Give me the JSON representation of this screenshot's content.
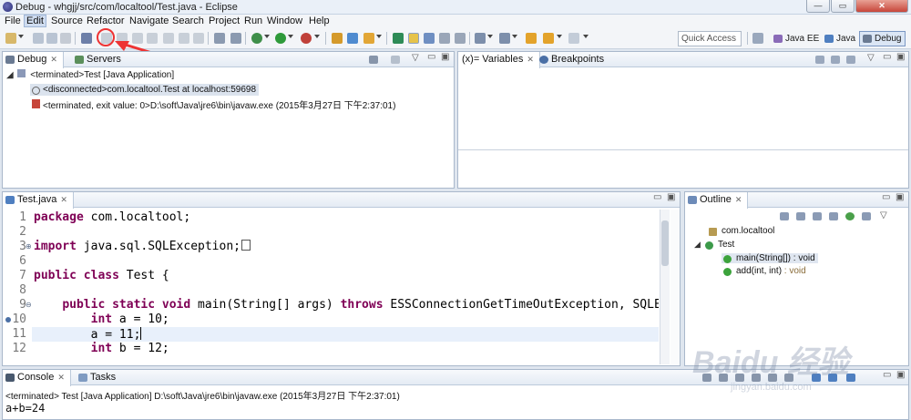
{
  "window": {
    "title": "Debug - whgjj/src/com/localtool/Test.java - Eclipse",
    "minimize_symbol": "—",
    "maximize_symbol": "▭",
    "close_symbol": "✕"
  },
  "menu": [
    "File",
    "Edit",
    "Source",
    "Refactor",
    "Navigate",
    "Search",
    "Project",
    "Run",
    "Window",
    "Help"
  ],
  "menu_active": "Edit",
  "toolbar": {
    "quick_access_placeholder": "Quick Access",
    "perspectives": [
      "Java EE",
      "Java",
      "Debug"
    ],
    "active_perspective": "Debug"
  },
  "debug_view": {
    "tabs": [
      "Debug",
      "Servers"
    ],
    "tree": [
      "<terminated>Test [Java Application]",
      "<disconnected>com.localtool.Test at localhost:59698",
      "<terminated, exit value: 0>D:\\soft\\Java\\jre6\\bin\\javaw.exe (2015年3月27日 下午2:37:01)"
    ]
  },
  "variables_view": {
    "tabs": [
      "(x)= Variables",
      "Breakpoints"
    ]
  },
  "editor": {
    "tab": "Test.java",
    "lines": [
      {
        "num": "1",
        "code": [
          {
            "t": "package",
            "kw": true
          },
          {
            "t": " com.localtool;"
          }
        ]
      },
      {
        "num": "2",
        "code": []
      },
      {
        "num": "3",
        "code": [
          {
            "t": "import",
            "kw": true
          },
          {
            "t": " java.sql.SQLException;"
          }
        ],
        "fold": "+",
        "box": true
      },
      {
        "num": "6",
        "code": []
      },
      {
        "num": "7",
        "code": [
          {
            "t": "public class",
            "kw": true
          },
          {
            "t": " Test {"
          }
        ]
      },
      {
        "num": "8",
        "code": []
      },
      {
        "num": "9",
        "code": [
          {
            "t": "    "
          },
          {
            "t": "public static void",
            "kw": true
          },
          {
            "t": " main(String[] args) "
          },
          {
            "t": "throws",
            "kw": true
          },
          {
            "t": " ESSConnectionGetTimeOutException, SQLExcepti"
          }
        ],
        "fold": "−"
      },
      {
        "num": "10",
        "code": [
          {
            "t": "        "
          },
          {
            "t": "int",
            "kw": true
          },
          {
            "t": " a = 10;"
          }
        ],
        "breakpoint": true
      },
      {
        "num": "11",
        "code": [
          {
            "t": "        a = 11;"
          }
        ],
        "highlight": true,
        "caret": true
      },
      {
        "num": "12",
        "code": [
          {
            "t": "        "
          },
          {
            "t": "int",
            "kw": true
          },
          {
            "t": " b = 12;"
          }
        ]
      }
    ]
  },
  "outline_view": {
    "tab": "Outline",
    "items": [
      {
        "label": "com.localtool",
        "kind": "package"
      },
      {
        "label": "Test",
        "kind": "class"
      },
      {
        "label": "main(String[]) : void",
        "kind": "method",
        "static": true
      },
      {
        "label": "add(int, int)",
        "suffix": " : void",
        "kind": "method",
        "static": true
      }
    ]
  },
  "console_view": {
    "tabs": [
      "Console",
      "Tasks"
    ],
    "status": "<terminated> Test [Java Application] D:\\soft\\Java\\jre6\\bin\\javaw.exe (2015年3月27日 下午2:37:01)",
    "output": "a+b=24"
  },
  "watermark": "Baidu 经验",
  "watermark_sub": "jingyan.baidu.com",
  "colors": {
    "keyword": "#7f0055",
    "callout": "#e33333",
    "active_perspective": "#dbe6f5"
  }
}
